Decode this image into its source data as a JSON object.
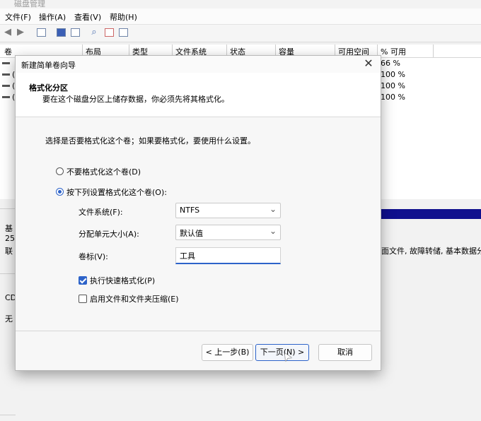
{
  "app": {
    "title": "磁盘管理"
  },
  "menu": [
    "文件(F)",
    "操作(A)",
    "查看(V)",
    "帮助(H)"
  ],
  "volume_list": {
    "columns": [
      "卷",
      "布局",
      "类型",
      "文件系统",
      "状态",
      "容量",
      "可用空间",
      "% 可用"
    ],
    "rows": [
      {
        "volume": "",
        "percent_free": "66 %"
      },
      {
        "volume": "(",
        "percent_free": "100 %"
      },
      {
        "volume": "(",
        "percent_free": "100 %"
      },
      {
        "volume": "(",
        "percent_free": "100 %"
      }
    ]
  },
  "lower_pane": {
    "disk_label_1": "基",
    "disk_label_2": "25",
    "disk_label_3": "联",
    "partition_text": "面文件, 故障转储, 基本数据分",
    "cd_label": "CD",
    "cd_status": "无"
  },
  "wizard": {
    "title": "新建简单卷向导",
    "header_title": "格式化分区",
    "header_desc": "要在这个磁盘分区上储存数据，你必须先将其格式化。",
    "instruction": "选择是否要格式化这个卷；如果要格式化，要使用什么设置。",
    "option_no_format": "不要格式化这个卷(D)",
    "option_format": "按下列设置格式化这个卷(O):",
    "file_system_label": "文件系统(F):",
    "file_system_value": "NTFS",
    "alloc_unit_label": "分配单元大小(A):",
    "alloc_unit_value": "默认值",
    "volume_label_label": "卷标(V):",
    "volume_label_value": "工具",
    "quick_format_label": "执行快速格式化(P)",
    "quick_format_checked": true,
    "compression_label": "启用文件和文件夹压缩(E)",
    "compression_checked": false,
    "back_button": "< 上一步(B)",
    "next_button": "下一页(N) >",
    "cancel_button": "取消"
  },
  "colors": {
    "accent": "#2d63c9",
    "disk_bar": "#10108e"
  }
}
